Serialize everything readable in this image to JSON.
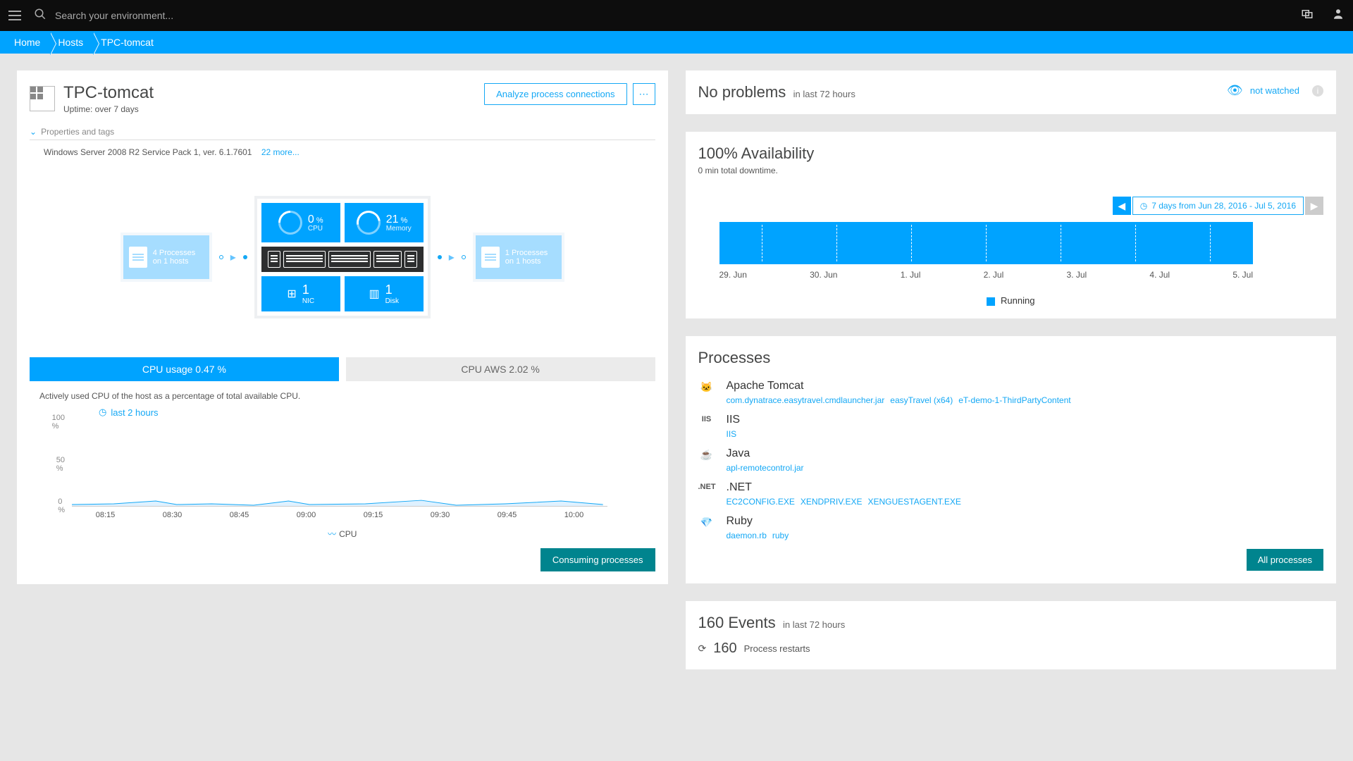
{
  "topbar": {
    "search_placeholder": "Search your environment..."
  },
  "breadcrumb": [
    "Home",
    "Hosts",
    "TPC-tomcat"
  ],
  "host": {
    "title": "TPC-tomcat",
    "uptime": "Uptime: over 7 days",
    "props_label": "Properties and tags",
    "props_text": "Windows Server 2008 R2 Service Pack 1, ver. 6.1.7601",
    "props_more": "22 more...",
    "analyze_btn": "Analyze process connections"
  },
  "topology": {
    "left_box_l1": "4 Processes",
    "left_box_l2": "on 1 hosts",
    "right_box_l1": "1 Processes",
    "right_box_l2": "on 1 hosts",
    "cpu_val": "0",
    "cpu_unit": "%",
    "cpu_lbl": "CPU",
    "mem_val": "21",
    "mem_unit": "%",
    "mem_lbl": "Memory",
    "nic_val": "1",
    "nic_lbl": "NIC",
    "disk_val": "1",
    "disk_lbl": "Disk"
  },
  "cpu": {
    "tab_active": "CPU usage 0.47 %",
    "tab_inactive": "CPU AWS 2.02 %",
    "desc": "Actively used CPU of the host as a percentage of total available CPU.",
    "last_hours": "last 2 hours",
    "legend": "CPU",
    "btn": "Consuming processes",
    "chart_data": {
      "type": "line",
      "ylim": [
        0,
        100
      ],
      "yticks": [
        "100 %",
        "50 %",
        "0 %"
      ],
      "xticks": [
        "08:15",
        "08:30",
        "08:45",
        "09:00",
        "09:15",
        "09:30",
        "09:45",
        "10:00"
      ],
      "series": [
        {
          "name": "CPU",
          "values": [
            1,
            3,
            1,
            2,
            1,
            4,
            1,
            2,
            1,
            3,
            1,
            2
          ]
        }
      ]
    }
  },
  "problems": {
    "title": "No problems",
    "sub": "in last 72 hours",
    "watched": "not watched"
  },
  "availability": {
    "title": "100% Availability",
    "downtime": "0 min total downtime.",
    "range": "7 days from Jun 28, 2016 - Jul 5, 2016",
    "xticks": [
      "29. Jun",
      "30. Jun",
      "1. Jul",
      "2. Jul",
      "3. Jul",
      "4. Jul",
      "5. Jul"
    ],
    "legend": "Running"
  },
  "processes": {
    "title": "Processes",
    "groups": [
      {
        "icon": "tomcat",
        "label": "Apache Tomcat",
        "links": [
          "com.dynatrace.easytravel.cmdlauncher.jar",
          "easyTravel (x64)",
          "eT-demo-1-ThirdPartyContent"
        ]
      },
      {
        "icon": "IIS",
        "label": "IIS",
        "links": [
          "IIS"
        ]
      },
      {
        "icon": "java",
        "label": "Java",
        "links": [
          "apl-remotecontrol.jar"
        ]
      },
      {
        "icon": ".NET",
        "label": ".NET",
        "links": [
          "EC2CONFIG.EXE",
          "XENDPRIV.EXE",
          "XENGUESTAGENT.EXE"
        ]
      },
      {
        "icon": "ruby",
        "label": "Ruby",
        "links": [
          "daemon.rb",
          "ruby"
        ]
      }
    ],
    "all_btn": "All processes"
  },
  "events": {
    "title": "160 Events",
    "sub": "in last 72 hours",
    "count": "160",
    "label": "Process restarts"
  }
}
